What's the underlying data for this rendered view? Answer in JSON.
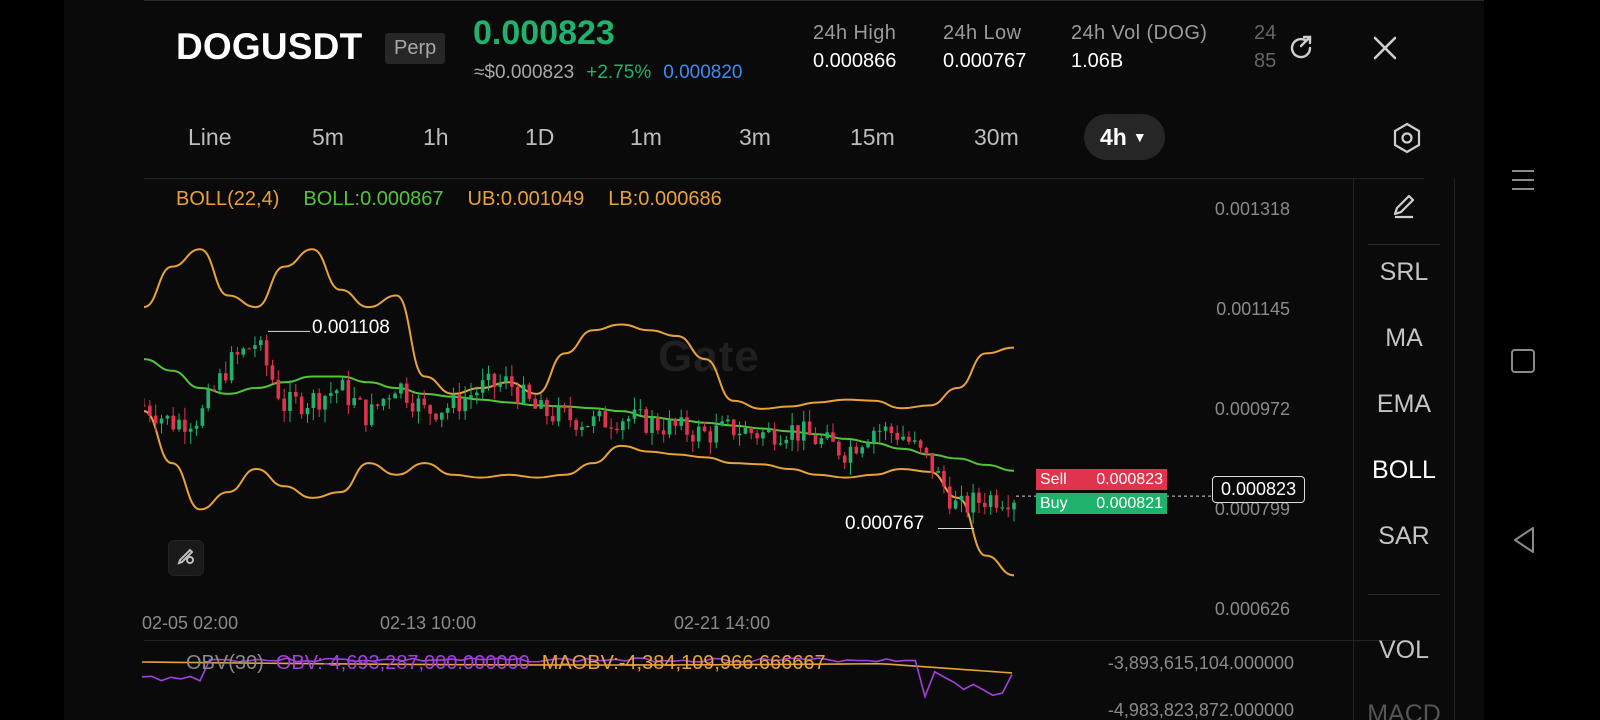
{
  "header": {
    "pair": "DOGUSDT",
    "badge": "Perp",
    "last_price": "0.000823",
    "usd_price": "≈$0.000823",
    "change_pct": "+2.75%",
    "mark_price": "0.000820",
    "stats": [
      {
        "label": "24h  High",
        "value": "0.000866"
      },
      {
        "label": "24h  Low",
        "value": "0.000767"
      },
      {
        "label": "24h  Vol (DOG)",
        "value": "1.06B"
      }
    ],
    "clipped_stat": {
      "label": "24",
      "value": "85"
    }
  },
  "intervals": [
    "Line",
    "5m",
    "1h",
    "1D",
    "1m",
    "3m",
    "15m",
    "30m",
    "4h"
  ],
  "active_interval": "4h",
  "boll_legend": {
    "name": "BOLL(22,4)",
    "mid": "BOLL:0.000867",
    "ub": "UB:0.001049",
    "lb": "LB:0.000686"
  },
  "watermark": "Gate",
  "annotations": {
    "high": "0.001108",
    "low": "0.000767"
  },
  "order_book": {
    "sell_label": "Sell",
    "sell_price": "0.000823",
    "buy_label": "Buy",
    "buy_price": "0.000821"
  },
  "current_price_tag": "0.000823",
  "side_menu": [
    "SRL",
    "MA",
    "EMA",
    "BOLL",
    "SAR",
    "VOL",
    "MACD"
  ],
  "side_menu_active": "BOLL",
  "obv_legend": {
    "name": "OBV(30)",
    "obv": "OBV:-4,693,287,000.000000",
    "maobv": "MAOBV:-4,384,109,966.666667"
  },
  "obv_axis": [
    "-3,893,615,104.000000",
    "-4,983,823,872.000000"
  ],
  "colors": {
    "up": "#20b26c",
    "down": "#e0344e",
    "boll_mid": "#53c43a",
    "boll_band": "#e8a23a",
    "obv": "#a63fe0",
    "maobv": "#e8a23a",
    "mark": "#3d8cf5"
  },
  "chart_data": {
    "type": "line",
    "title": "",
    "y_axis": {
      "ticks": [
        "0.001318",
        "0.001145",
        "0.000972",
        "0.000799",
        "0.000626"
      ],
      "range": [
        0.000626,
        0.001318
      ]
    },
    "x_axis": {
      "ticks": [
        "02-05 02:00",
        "02-13 10:00",
        "02-21 14:00"
      ]
    },
    "series": [
      {
        "name": "UB",
        "values": [
          0.00115,
          0.00122,
          0.00125,
          0.00117,
          0.00115,
          0.00122,
          0.00125,
          0.00118,
          0.00115,
          0.00117,
          0.00103,
          0.001,
          0.00101,
          0.00102,
          0.001,
          0.00107,
          0.00111,
          0.00112,
          0.00111,
          0.0011,
          0.00106,
          0.000988,
          0.000974,
          0.000978,
          0.000985,
          0.00099,
          0.000988,
          0.000975,
          0.00098,
          0.00101,
          0.00107,
          0.00108
        ]
      },
      {
        "name": "BOLL",
        "values": [
          0.00106,
          0.00104,
          0.00101,
          0.001,
          0.00101,
          0.00102,
          0.00103,
          0.00103,
          0.00102,
          0.00101,
          0.001,
          0.000995,
          0.00099,
          0.000985,
          0.00098,
          0.000978,
          0.000975,
          0.00097,
          0.00096,
          0.000955,
          0.00095,
          0.000945,
          0.00094,
          0.000935,
          0.00093,
          0.000922,
          0.000915,
          0.000905,
          0.000895,
          0.000888,
          0.000877,
          0.000867
        ]
      },
      {
        "name": "LB",
        "values": [
          0.00097,
          0.00088,
          0.0008,
          0.00083,
          0.00087,
          0.00084,
          0.00082,
          0.00083,
          0.00088,
          0.00086,
          0.00088,
          0.00086,
          0.000855,
          0.00086,
          0.000855,
          0.00086,
          0.00088,
          0.00091,
          0.0009,
          0.000895,
          0.00089,
          0.00088,
          0.000878,
          0.00087,
          0.00086,
          0.000855,
          0.00086,
          0.00087,
          0.000865,
          0.00082,
          0.00072,
          0.000686
        ]
      },
      {
        "name": "Close",
        "values": [
          0.00098,
          0.00095,
          0.00096,
          0.00105,
          0.00109,
          0.00098,
          0.00099,
          0.00101,
          0.00096,
          0.00102,
          0.00097,
          0.00098,
          0.00101,
          0.00102,
          0.00097,
          0.00096,
          0.00095,
          0.00096,
          0.00095,
          0.00094,
          0.00093,
          0.00094,
          0.00093,
          0.00094,
          0.00092,
          0.0009,
          0.00094,
          0.00093,
          0.00088,
          0.0008,
          0.00082,
          0.000823
        ]
      }
    ]
  }
}
